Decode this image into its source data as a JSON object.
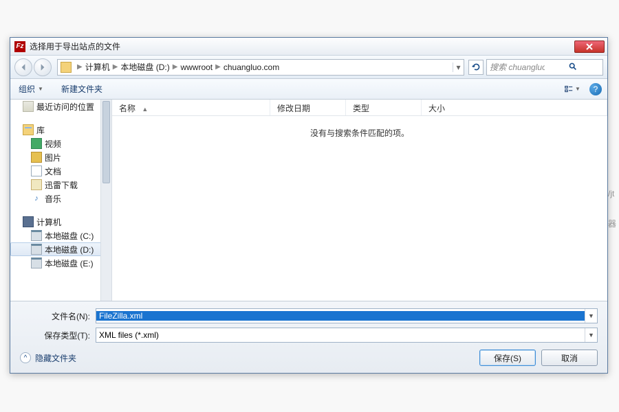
{
  "titlebar": {
    "title": "选择用于导出站点的文件",
    "icon_text": "Fz"
  },
  "breadcrumb": {
    "segments": [
      "计算机",
      "本地磁盘 (D:)",
      "wwwroot",
      "chuangluo.com"
    ]
  },
  "search": {
    "placeholder": "搜索 chuangluo.com"
  },
  "toolbar": {
    "organize": "组织",
    "new_folder": "新建文件夹"
  },
  "tree": {
    "recent": "最近访问的位置",
    "library": "库",
    "video": "视频",
    "pictures": "图片",
    "documents": "文档",
    "thunder": "迅雷下载",
    "music": "音乐",
    "computer": "计算机",
    "drive_c": "本地磁盘 (C:)",
    "drive_d": "本地磁盘 (D:)",
    "drive_e": "本地磁盘 (E:)"
  },
  "columns": {
    "name": "名称",
    "modified": "修改日期",
    "type": "类型",
    "size": "大小"
  },
  "list": {
    "empty_message": "没有与搜索条件匹配的项。"
  },
  "filename": {
    "label": "文件名(N):",
    "value": "FileZilla.xml"
  },
  "filetype": {
    "label": "保存类型(T):",
    "value": "XML files (*.xml)"
  },
  "footer": {
    "hide_folders": "隐藏文件夹",
    "save": "保存(S)",
    "cancel": "取消"
  }
}
